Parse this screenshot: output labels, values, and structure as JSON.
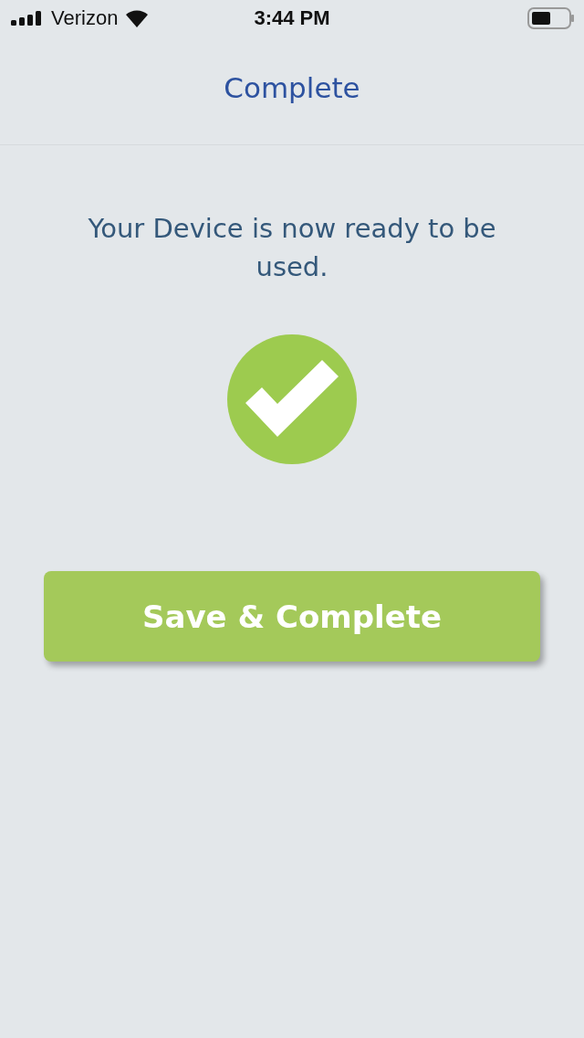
{
  "status_bar": {
    "carrier": "Verizon",
    "time": "3:44 PM"
  },
  "nav": {
    "title": "Complete"
  },
  "message": "Your Device is now ready to be used.",
  "button": {
    "label": "Save & Complete"
  }
}
